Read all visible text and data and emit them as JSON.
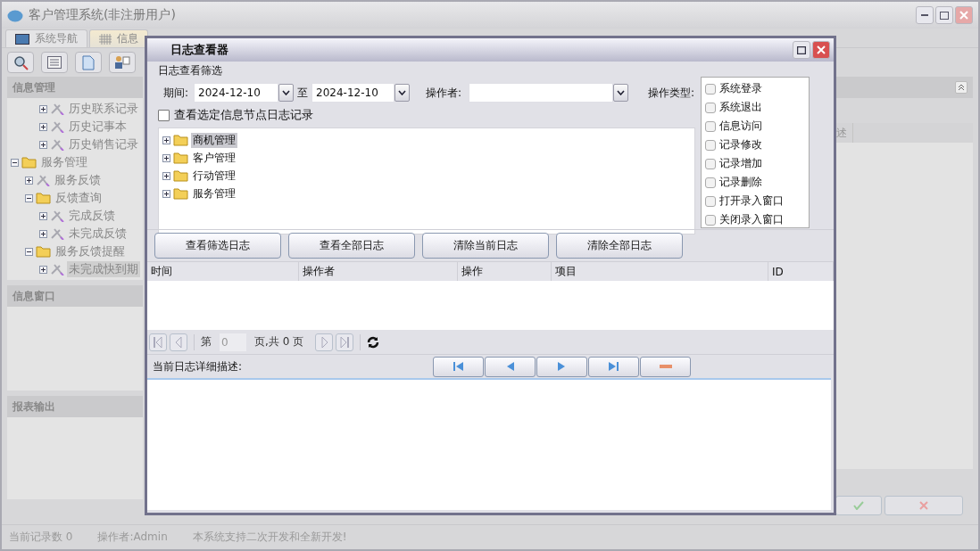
{
  "window": {
    "title": "客户管理系统(非注册用户)"
  },
  "tabs": [
    {
      "label": "系统导航",
      "selected": false
    },
    {
      "label": "信息",
      "selected": true
    }
  ],
  "left_panels": [
    {
      "title": "信息管理",
      "kind": "tree"
    },
    {
      "title": "信息窗口",
      "kind": "blank"
    },
    {
      "title": "报表输出",
      "kind": "blank"
    }
  ],
  "nav_tree": {
    "partial_items": [
      {
        "label": "历史联系记录",
        "kind": "tool",
        "expanded": false,
        "selected": false
      },
      {
        "label": "历史记事本",
        "kind": "tool",
        "expanded": false,
        "selected": false
      },
      {
        "label": "历史销售记录",
        "kind": "tool",
        "expanded": false,
        "selected": false
      }
    ],
    "items": [
      {
        "label": "服务管理",
        "kind": "folder",
        "expanded": true,
        "selected": false,
        "children": [
          {
            "label": "服务反馈",
            "kind": "tool",
            "expanded": false,
            "selected": false
          },
          {
            "label": "反馈查询",
            "kind": "folder",
            "expanded": true,
            "selected": false,
            "children": [
              {
                "label": "完成反馈",
                "kind": "tool",
                "expanded": false,
                "selected": false
              },
              {
                "label": "未完成反馈",
                "kind": "tool",
                "expanded": false,
                "selected": false
              }
            ]
          },
          {
            "label": "服务反馈提醒",
            "kind": "folder",
            "expanded": true,
            "selected": false,
            "children": [
              {
                "label": "未完成快到期",
                "kind": "tool",
                "expanded": false,
                "selected": true
              }
            ]
          }
        ]
      }
    ]
  },
  "right_panel": {
    "columns": [
      "述"
    ],
    "buttons": [
      {
        "kind": "confirm"
      },
      {
        "kind": "cancel"
      }
    ]
  },
  "status_bar": [
    "当前记录数 0",
    "操作者:Admin",
    "本系统支持二次开发和全新开发!"
  ],
  "dialog": {
    "title": "日志查看器",
    "filter": {
      "group_label": "日志查看筛选",
      "period_label": "期间:",
      "date_from": "2024-12-10",
      "to_label": "至",
      "date_to": "2024-12-10",
      "operator_label": "操作者:",
      "operation_type_label": "操作类型:",
      "node_only": {
        "label": "查看选定信息节点日志记录",
        "checked": false
      }
    },
    "tree": [
      {
        "label": "商机管理",
        "expanded": false,
        "selected": true
      },
      {
        "label": "客户管理",
        "expanded": false,
        "selected": false
      },
      {
        "label": "行动管理",
        "expanded": false,
        "selected": false
      },
      {
        "label": "服务管理",
        "expanded": false,
        "selected": false
      }
    ],
    "operation_types": [
      {
        "label": "系统登录",
        "checked": false
      },
      {
        "label": "系统退出",
        "checked": false
      },
      {
        "label": "信息访问",
        "checked": false
      },
      {
        "label": "记录修改",
        "checked": false
      },
      {
        "label": "记录增加",
        "checked": false
      },
      {
        "label": "记录删除",
        "checked": false
      },
      {
        "label": "打开录入窗口",
        "checked": false
      },
      {
        "label": "关闭录入窗口",
        "checked": false
      }
    ],
    "buttons": [
      "查看筛选日志",
      "查看全部日志",
      "清除当前日志",
      "清除全部日志"
    ],
    "table": {
      "columns": [
        "时间",
        "操作者",
        "操作",
        "项目",
        "ID"
      ]
    },
    "pager": {
      "page_label": "第",
      "page": "0",
      "total": "页,共 0 页"
    },
    "detail": {
      "label": "当前日志详细描述:",
      "nav": [
        {
          "kind": "first"
        },
        {
          "kind": "prev"
        },
        {
          "kind": "next"
        },
        {
          "kind": "last"
        },
        {
          "kind": "remove"
        }
      ]
    }
  }
}
